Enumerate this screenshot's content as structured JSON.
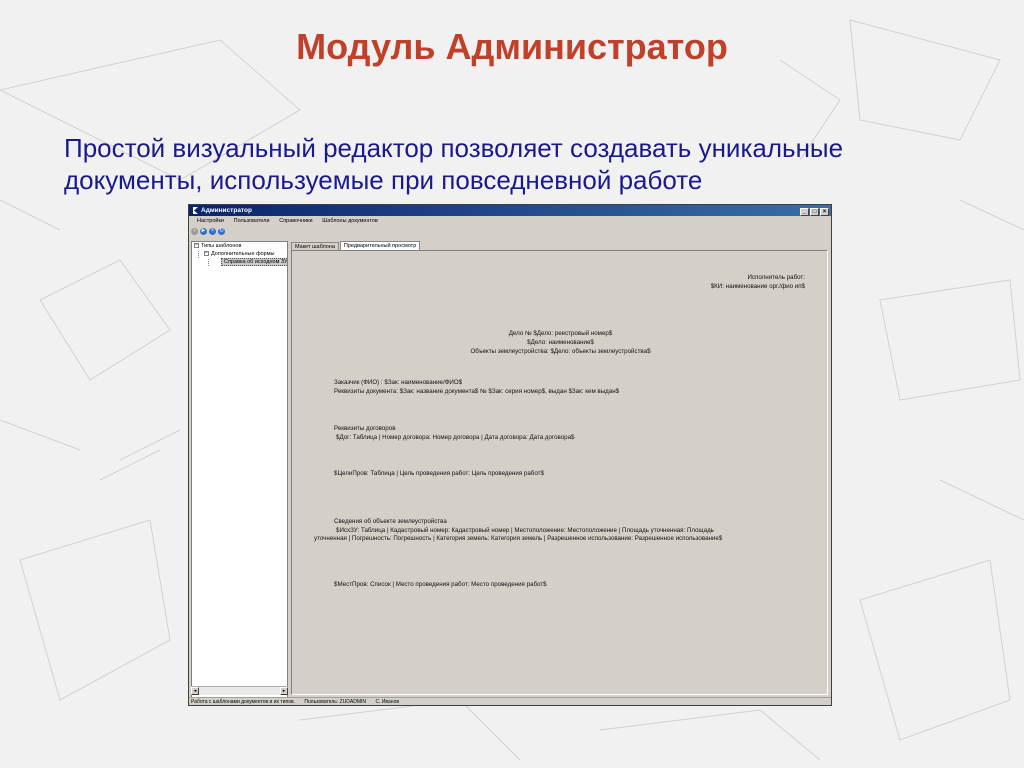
{
  "slide": {
    "title": "Модуль Администратор",
    "text_line1": "Простой визуальный редактор позволяет создавать уникальные",
    "text_line2": "документы, используемые при повседневной работе"
  },
  "colors": {
    "title": "#c0402a",
    "text": "#1a1a8c",
    "window_bg": "#d4d0c8",
    "titlebar_start": "#0a246a",
    "titlebar_end": "#3a6ea5"
  },
  "window": {
    "title": "Администратор",
    "controls": [
      "_",
      "□",
      "×"
    ]
  },
  "menu": [
    "Настройки",
    "Пользователи",
    "Справочники",
    "Шаблоны документов"
  ],
  "toolbar": {
    "icons": [
      "back-icon",
      "play-icon",
      "stop-icon",
      "info-icon"
    ],
    "glyphs": [
      "‹",
      "►",
      "×",
      "↻"
    ]
  },
  "tree": {
    "root": "Типы шаблонов",
    "child": "Дополнительные формы",
    "leaf": "Справка об исходном ЗУ"
  },
  "tabs": [
    "Макет шаблона",
    "Предварительный просмотр"
  ],
  "document": {
    "executor_label": "Исполнитель работ:",
    "executor_value": "$КИ: наименование орг./фио ип$",
    "case_no": "Дело № $Дело: реестровый номер$",
    "case_name": "$Дело: наименование$",
    "case_objects": "Объекты землеустройства: $Дело: объекты землеустройства$",
    "customer": "Заказчик (ФИО) : $Зак: наименование/ФИО$",
    "customer_doc": "Реквизиты документа: $Зак: название документа$ №  $Зак: серия номер$, выдан $Зак: кем выдан$",
    "contracts_label": "Реквизиты договоров",
    "contracts_value": "$Дог: Таблица | Номер договора: Номер договора | Дата договора: Дата договора$",
    "purpose": "$ЦелиПров: Таблица | Цель проведения работ: Цель проведения работ$",
    "object_label": "Сведения об объекте землеустройства",
    "object_line1": "$ИсхЗУ: Таблица | Кадастровый номер: Кадастровый номер | Местоположение: Местоположение | Площадь уточненная: Площадь",
    "object_line2": "уточненная | Погрешность: Погрешность | Категория земель: Категория земель | Разрешенное использование: Разрешенное использование$",
    "place": "$МестПров: Список | Место проведения работ: Место проведения работ$"
  },
  "status": {
    "info": "Работа с шаблонами документов и их типов.",
    "user": "Пользователь: ZUDADMIN",
    "name": "С. Иванов"
  }
}
